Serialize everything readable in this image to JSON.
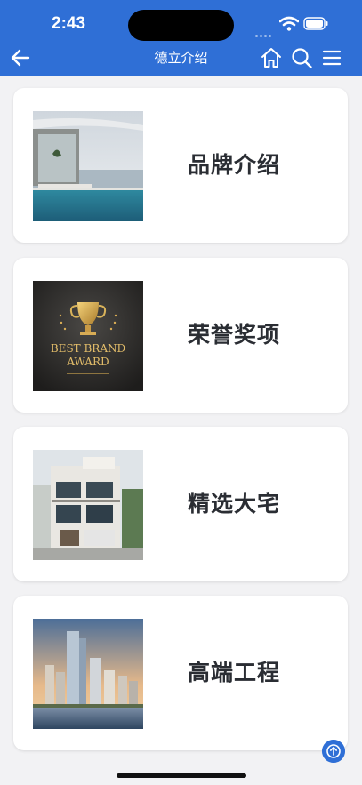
{
  "status_bar": {
    "time": "2:43"
  },
  "header": {
    "title": "德立介绍"
  },
  "items": [
    {
      "label": "品牌介绍"
    },
    {
      "label": "荣誉奖项"
    },
    {
      "label": "精选大宅"
    },
    {
      "label": "高端工程"
    }
  ],
  "award_image": {
    "line1": "BEST BRAND",
    "line2": "AWARD"
  },
  "colors": {
    "accent": "#2f6fd6",
    "background": "#f2f2f4",
    "card": "#ffffff",
    "text": "#2a2d33"
  },
  "icons": [
    "back-arrow-icon",
    "home-icon",
    "search-icon",
    "menu-icon",
    "wifi-icon",
    "battery-icon",
    "arrow-up-icon"
  ]
}
